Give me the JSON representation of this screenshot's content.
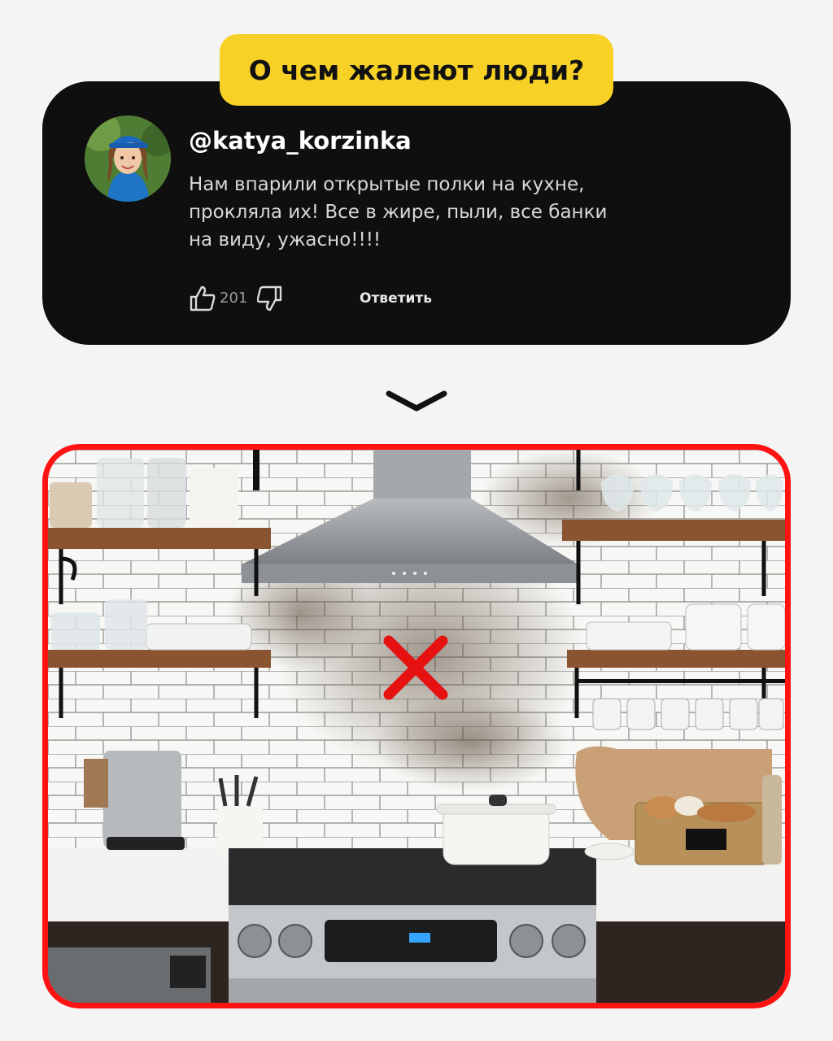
{
  "header": {
    "title": "О чем жалеют люди?"
  },
  "comment": {
    "username": "@katya_korzinka",
    "text": "Нам впарили открытые полки на кухне,\nпрокляла их! Все в жире, пыли, все банки\nна виду, ужасно!!!!",
    "likes": "201",
    "reply_label": "Ответить"
  },
  "colors": {
    "accent": "#f7d125",
    "card": "#0f0f0f",
    "frame": "#ff1212"
  },
  "icons": [
    "thumbs-up-icon",
    "thumbs-down-icon",
    "chevron-down-icon",
    "red-cross-icon"
  ]
}
